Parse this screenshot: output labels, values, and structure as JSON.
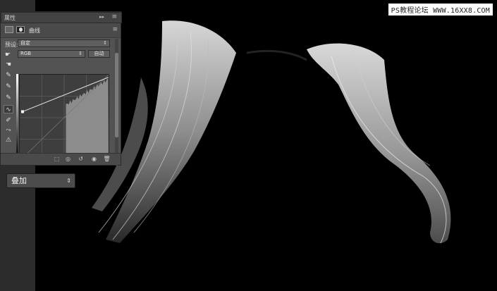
{
  "watermark": "PS教程论坛 WWW.16XX8.COM",
  "panel": {
    "title": "属性",
    "collapse_glyph": "▸▸",
    "close_glyph": "≡",
    "adjustment_name": "曲线",
    "menu_glyph": "≡",
    "preset_label": "预设:",
    "preset_value": "自定",
    "channel_value": "RGB",
    "auto_label": "自动",
    "curve": {
      "point_left_output": 0.57,
      "point_right_output": 0.97
    }
  },
  "tools": [
    {
      "name": "on-image-adjust-tool",
      "glyph": "☚"
    },
    {
      "name": "black-point-eyedropper",
      "glyph": "✎"
    },
    {
      "name": "gray-point-eyedropper",
      "glyph": "✎"
    },
    {
      "name": "white-point-eyedropper",
      "glyph": "✎"
    },
    {
      "name": "curve-edit-tool",
      "glyph": "∿"
    },
    {
      "name": "pencil-tool",
      "glyph": "✐"
    },
    {
      "name": "smooth-tool",
      "glyph": "⤳"
    },
    {
      "name": "histogram-warning-tool",
      "glyph": "⚠"
    }
  ],
  "footer_icons": [
    "clip-to-layer",
    "view-previous",
    "reset",
    "visibility",
    "delete"
  ],
  "blend_mode": {
    "value": "叠加"
  },
  "colors": {
    "panel_bg": "#535353",
    "canvas_bg": "#000000",
    "hair_highlight": "#d9d9d9"
  }
}
